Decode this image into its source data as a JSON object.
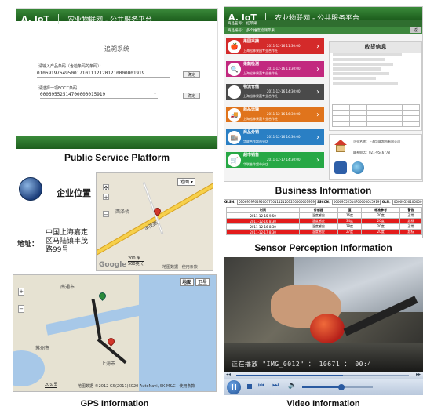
{
  "captions": {
    "public": "Public Service Platform",
    "business": "Business Information",
    "sensor": "Sensor Perception Information",
    "gps": "GPS Information",
    "video": "Video Information"
  },
  "platform": {
    "brand": "A. IoT",
    "title": "农业物联网 - 公共服务平台"
  },
  "trace": {
    "heading": "追溯系统",
    "input_label": "请输入产品条码（含检条码的条码）：",
    "barcode": "01069197649500171011121201210000001919",
    "query_btn": "确定",
    "select_label": "请选择一项EOCC条码：",
    "selected_code": "00069552514700000015919",
    "query2_btn": "确定"
  },
  "business": {
    "nav1": "商品名称：  红苹果",
    "nav2": "商品编号：  多个维度检测苹果",
    "nav_btn": "返",
    "panel_title": "收货信息",
    "cards": [
      {
        "title": "果园采摘",
        "sub": "上海松林果园专业合作社",
        "time": "2011-12-16 11:30:00",
        "color": "#d42a2a",
        "icon": "apple-icon"
      },
      {
        "title": "果蔬检测",
        "sub": "上海松林果蔬专业合作社",
        "time": "2011-12-16 11:30:00",
        "color": "#c2297f",
        "icon": "inspection-icon"
      },
      {
        "title": "物流仓储",
        "sub": "上海松林果蔬专业合作社",
        "time": "2011-12-16 14:30:00",
        "color": "#4a4a4a",
        "icon": "warehouse-icon"
      },
      {
        "title": "商品运输",
        "sub": "上海松林果蔬专业合作社",
        "time": "2011-12-16 16:30:00",
        "color": "#e0741c",
        "icon": "truck-icon"
      },
      {
        "title": "商品分销",
        "sub": "华联合作超市分店",
        "time": "2011-12-16 16:30:00",
        "color": "#2a7fc4",
        "icon": "store-icon"
      },
      {
        "title": "超市销售",
        "sub": "华联合作超市分店",
        "time": "2011-12-17 14:30:00",
        "color": "#27a845",
        "icon": "cart-icon"
      }
    ],
    "company": {
      "label1": "企业名称：",
      "value1": "上海华联超市有限公司",
      "label2": "联系电话：",
      "value2": "021-9546778"
    }
  },
  "gps": {
    "heading": "企业位置",
    "addr_label": "地址：",
    "address": "中国上海嘉定区马陆镇丰茂路99号",
    "map_type": "地图",
    "road_name": "丰茂路",
    "place": "西泽桥",
    "scale1": "200 米",
    "scale2": "500英尺",
    "attribution": "地图数据 · 使用条款",
    "google": "Google",
    "map2_btn1": "地图",
    "map2_btn2": "卫星",
    "city1": "苏州市",
    "city2": "上海市",
    "city3": "南通市",
    "scale3": "20公里",
    "attribution2": "地图数据 ©2012 GS(2011)6020 AutoNavi, SK M&C - 使用条款"
  },
  "sensor": {
    "header": [
      {
        "label": "GLSN：",
        "value": "01069197649500171011121201210000001919"
      },
      {
        "label": "SSCCN：",
        "value": "00069552514700000015919"
      },
      {
        "label": "GLN：",
        "value": "00069550100000"
      }
    ],
    "columns": [
      "时间",
      "传感器",
      "值",
      "标准参考",
      "警告"
    ],
    "rows": [
      {
        "time": "2011-12-15 9:50",
        "sensor": "温度感应",
        "value": "16度",
        "ref": "20度",
        "alert": "正常",
        "status": "normal"
      },
      {
        "time": "2011-12-16 8:30",
        "sensor": "温度感应",
        "value": "34度",
        "ref": "20度",
        "alert": "超标",
        "status": "alert"
      },
      {
        "time": "2011-12-16 8:30",
        "sensor": "温度感应",
        "value": "28度",
        "ref": "20度",
        "alert": "正常",
        "status": "normal"
      },
      {
        "time": "2011-12-17 8:30",
        "sensor": "温度感应",
        "value": "27度",
        "ref": "20度",
        "alert": "超标",
        "status": "alert"
      }
    ]
  },
  "video": {
    "caption": "正在播放 \"IMG_0012\" ：  10671 ：     00:4",
    "progress": 0.62,
    "volume": 0.55
  }
}
